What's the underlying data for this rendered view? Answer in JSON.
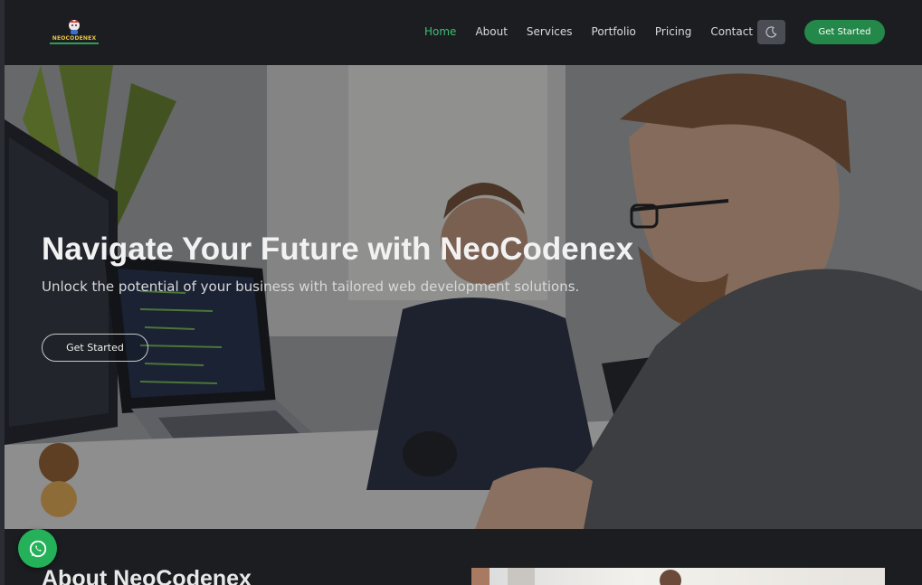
{
  "header": {
    "logo_text": "NEOCODENEX",
    "nav": [
      {
        "label": "Home",
        "active": true
      },
      {
        "label": "About",
        "active": false
      },
      {
        "label": "Services",
        "active": false
      },
      {
        "label": "Portfolio",
        "active": false
      },
      {
        "label": "Pricing",
        "active": false
      },
      {
        "label": "Contact",
        "active": false
      }
    ],
    "theme_toggle_icon": "moon-icon",
    "cta_label": "Get Started"
  },
  "hero": {
    "title": "Navigate Your Future with NeoCodenex",
    "subtitle": "Unlock the potential of your business with tailored web development solutions.",
    "cta_label": "Get Started"
  },
  "about": {
    "title": "About NeoCodenex"
  },
  "floating": {
    "whatsapp_icon": "whatsapp-icon"
  },
  "colors": {
    "accent": "#23884a",
    "nav_active": "#3fbf73",
    "background": "#1b1d21"
  }
}
